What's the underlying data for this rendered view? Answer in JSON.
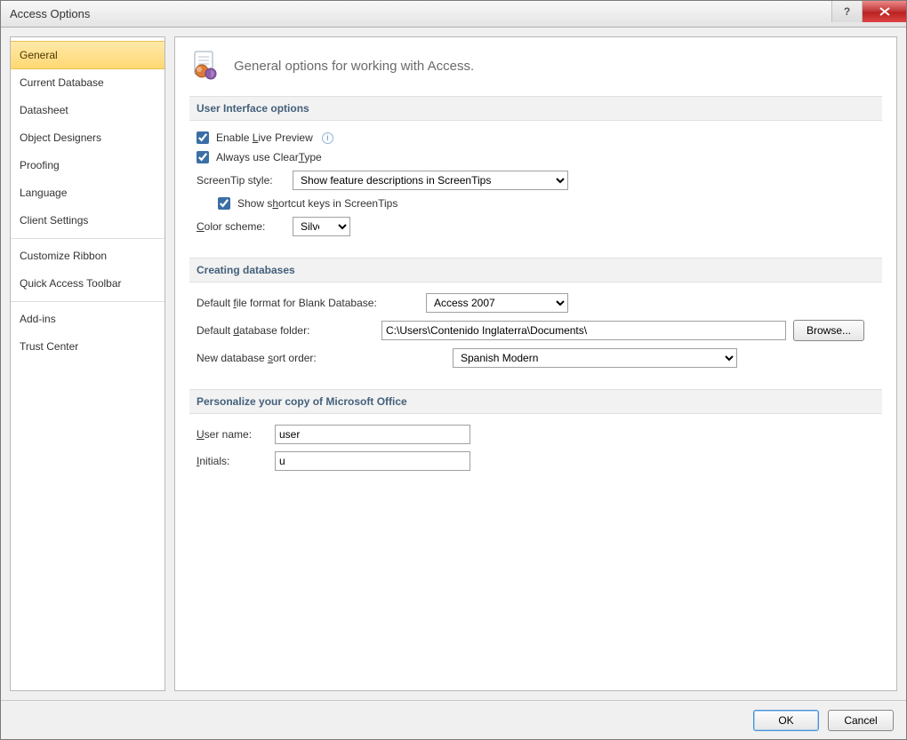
{
  "window": {
    "title": "Access Options"
  },
  "sidebar": {
    "items": [
      "General",
      "Current Database",
      "Datasheet",
      "Object Designers",
      "Proofing",
      "Language",
      "Client Settings",
      "Customize Ribbon",
      "Quick Access Toolbar",
      "Add-ins",
      "Trust Center"
    ],
    "selected_index": 0
  },
  "main": {
    "heading": "General options for working with Access.",
    "section_ui": {
      "title": "User Interface options",
      "enable_live_preview": {
        "label": "Enable Live Preview",
        "checked": true
      },
      "always_cleartype": {
        "label": "Always use ClearType",
        "checked": true
      },
      "screentip_style_label": "ScreenTip style:",
      "screentip_style_value": "Show feature descriptions in ScreenTips",
      "show_shortcut_keys": {
        "label": "Show shortcut keys in ScreenTips",
        "checked": true
      },
      "color_scheme_label": "Color scheme:",
      "color_scheme_value": "Silver"
    },
    "section_db": {
      "title": "Creating databases",
      "default_file_format_label": "Default file format for Blank Database:",
      "default_file_format_value": "Access 2007",
      "default_folder_label": "Default database folder:",
      "default_folder_value": "C:\\Users\\Contenido Inglaterra\\Documents\\",
      "browse": "Browse...",
      "sort_order_label": "New database sort order:",
      "sort_order_value": "Spanish Modern"
    },
    "section_personalize": {
      "title": "Personalize your copy of Microsoft Office",
      "username_label": "User name:",
      "username_value": "user",
      "initials_label": "Initials:",
      "initials_value": "u"
    }
  },
  "footer": {
    "ok": "OK",
    "cancel": "Cancel"
  }
}
